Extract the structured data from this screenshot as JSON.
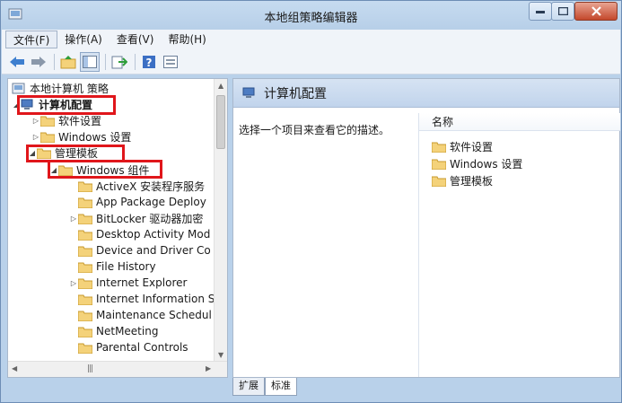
{
  "window": {
    "title": "本地组策略编辑器"
  },
  "menu": [
    "文件(F)",
    "操作(A)",
    "查看(V)",
    "帮助(H)"
  ],
  "toolbar": [
    "back-icon",
    "forward-icon",
    "up-folder-icon",
    "show-hide-tree-icon",
    "export-icon",
    "help-icon",
    "properties-icon"
  ],
  "tree": {
    "root": "本地计算机 策略",
    "computer_config": "计算机配置",
    "software": "软件设置",
    "windows_settings": "Windows 设置",
    "admin_templates": "管理模板",
    "windows_components": "Windows 组件",
    "items": [
      "ActiveX 安装程序服务",
      "App Package Deploy",
      "BitLocker 驱动器加密",
      "Desktop Activity Mod",
      "Device and Driver Co",
      "File History",
      "Internet Explorer",
      "Internet Information S",
      "Maintenance Schedul",
      "NetMeeting",
      "Parental Controls"
    ]
  },
  "right": {
    "header": "计算机配置",
    "description": "选择一个项目来查看它的描述。",
    "column": "名称",
    "items": [
      "软件设置",
      "Windows 设置",
      "管理模板"
    ]
  },
  "tabs": [
    "扩展",
    "标准"
  ],
  "colors": {
    "highlight": "#e0161b",
    "folder": "#f4d27a"
  }
}
